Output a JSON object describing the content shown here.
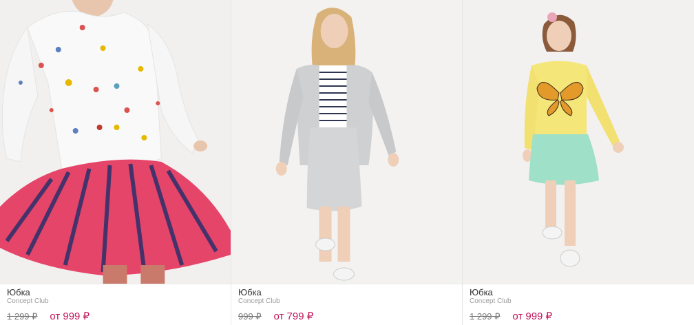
{
  "colors": {
    "price": "#c2185b",
    "old_price": "#777777",
    "brand": "#9a9a9a"
  },
  "products": [
    {
      "image": "girl-butterfly-sweatshirt-pink-tulle-skirt",
      "title": "Юбка",
      "brand": "Concept Club",
      "old_price": "1 299 ₽",
      "price": "от 999 ₽"
    },
    {
      "image": "girl-grey-bomber-striped-top-grey-skirt",
      "title": "Юбка",
      "brand": "Concept Club",
      "old_price": "999 ₽",
      "price": "от 799 ₽"
    },
    {
      "image": "girl-yellow-sweatshirt-mint-tulle-skirt",
      "title": "Юбка",
      "brand": "Concept Club",
      "old_price": "1 299 ₽",
      "price": "от 999 ₽"
    }
  ]
}
